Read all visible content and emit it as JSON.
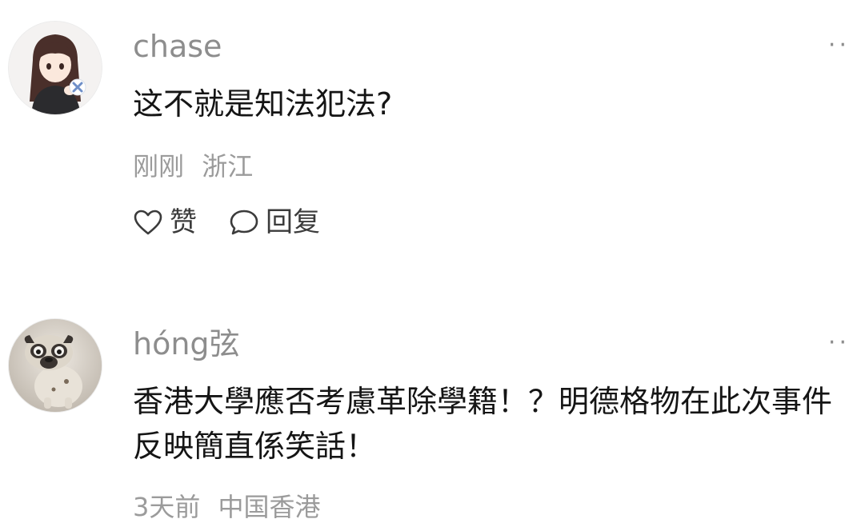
{
  "comments": [
    {
      "username": "chase",
      "text": "这不就是知法犯法?",
      "time": "刚刚",
      "location": "浙江",
      "like_label": "赞",
      "reply_label": "回复",
      "more_label": "··"
    },
    {
      "username": "hóng弦",
      "text": "香港大學應否考慮革除學籍！？明德格物在此次事件反映簡直係笑話！",
      "time": "3天前",
      "location": "中国香港",
      "more_label": "··"
    }
  ],
  "icons": {
    "like": "heart-outline-icon",
    "reply": "speech-bubble-icon",
    "more": "more-dots-icon"
  },
  "colors": {
    "username": "#8d8d8d",
    "body_text": "#151515",
    "meta_text": "#9b9b9b",
    "action_text": "#3b3b3b"
  }
}
